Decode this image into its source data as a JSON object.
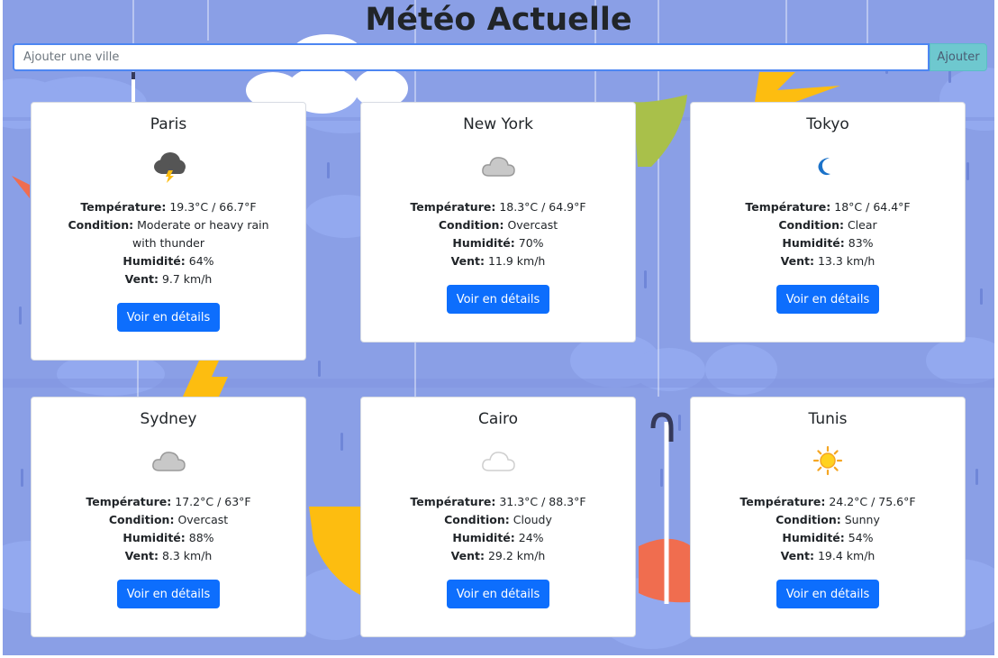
{
  "page": {
    "title": "Météo Actuelle"
  },
  "search": {
    "placeholder": "Ajouter une ville",
    "value": "",
    "button_label": "Ajouter"
  },
  "labels": {
    "temperature": "Température:",
    "condition": "Condition:",
    "humidity": "Humidité:",
    "wind": "Vent:"
  },
  "cards": [
    {
      "city": "Paris",
      "icon": "thunderstorm-cloud-icon",
      "temp": "19.3°C / 66.7°F",
      "condition": "Moderate or heavy rain with thunder",
      "humidity": "64%",
      "wind": "9.7 km/h",
      "button": "Voir en détails"
    },
    {
      "city": "New York",
      "icon": "overcast-cloud-icon",
      "temp": "18.3°C / 64.9°F",
      "condition": "Overcast",
      "humidity": "70%",
      "wind": "11.9 km/h",
      "button": "Voir en détails"
    },
    {
      "city": "Tokyo",
      "icon": "crescent-moon-icon",
      "temp": "18°C / 64.4°F",
      "condition": "Clear",
      "humidity": "83%",
      "wind": "13.3 km/h",
      "button": "Voir en détails"
    },
    {
      "city": "Sydney",
      "icon": "overcast-cloud-icon",
      "temp": "17.2°C / 63°F",
      "condition": "Overcast",
      "humidity": "88%",
      "wind": "8.3 km/h",
      "button": "Voir en détails"
    },
    {
      "city": "Cairo",
      "icon": "light-cloud-icon",
      "temp": "31.3°C / 88.3°F",
      "condition": "Cloudy",
      "humidity": "24%",
      "wind": "29.2 km/h",
      "button": "Voir en détails"
    },
    {
      "city": "Tunis",
      "icon": "sun-icon",
      "temp": "24.2°C / 75.6°F",
      "condition": "Sunny",
      "humidity": "54%",
      "wind": "19.4 km/h",
      "button": "Voir en détails"
    }
  ],
  "colors": {
    "background": "#8a9fe6",
    "primary_button": "#0d6efd",
    "add_button": "#6ec8cf",
    "umbrella_yellow": "#fdbd10",
    "umbrella_red": "#f06d4f",
    "umbrella_green": "#a9c04a"
  }
}
